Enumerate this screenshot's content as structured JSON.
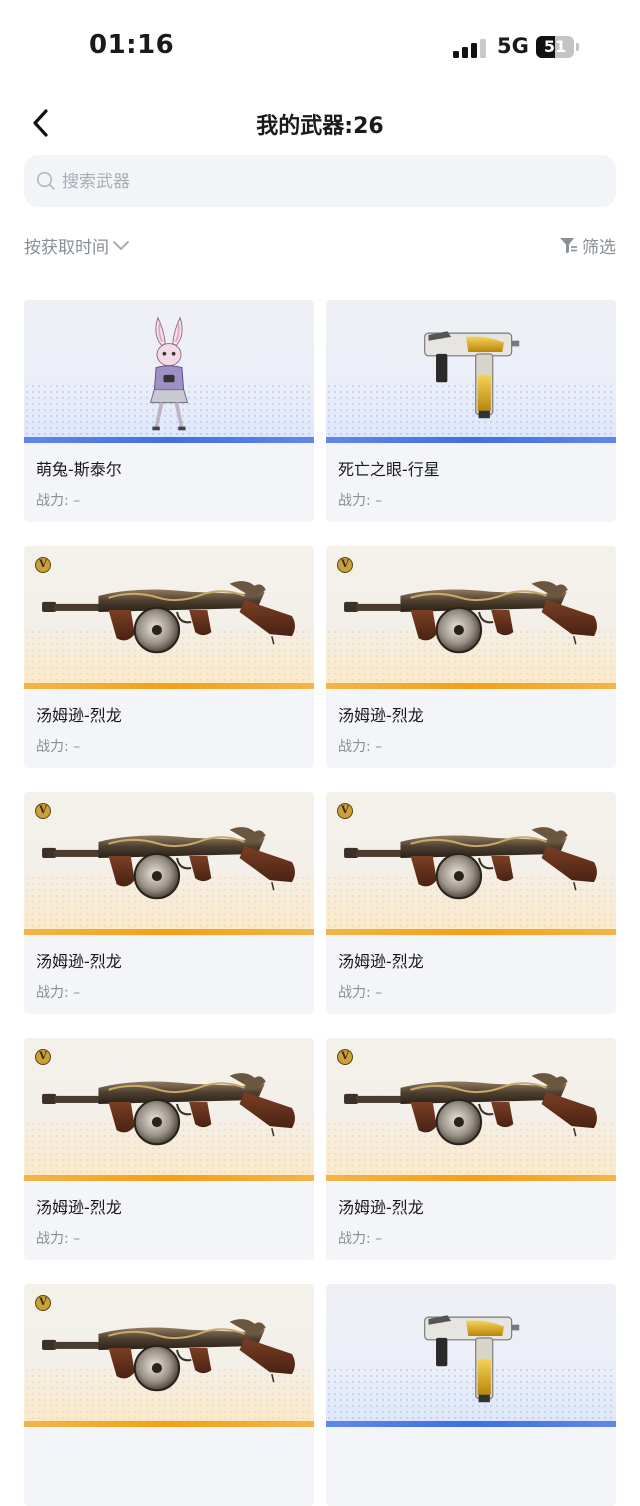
{
  "status": {
    "time": "01:16",
    "network": "5G",
    "battery": "51"
  },
  "header": {
    "title": "我的武器:26"
  },
  "search": {
    "placeholder": "搜索武器"
  },
  "toolbar": {
    "sort_label": "按获取时间",
    "filter_label": "筛选"
  },
  "weapons": [
    {
      "name": "萌兔-斯泰尔",
      "power": "战力: –",
      "rarity": "blue",
      "art": "bunny-character"
    },
    {
      "name": "死亡之眼-行星",
      "power": "战力: –",
      "rarity": "blue",
      "art": "smg-gold"
    },
    {
      "name": "汤姆逊-烈龙",
      "power": "战力: –",
      "rarity": "gold",
      "art": "thompson-dragon",
      "badge": "V"
    },
    {
      "name": "汤姆逊-烈龙",
      "power": "战力: –",
      "rarity": "gold",
      "art": "thompson-dragon",
      "badge": "V"
    },
    {
      "name": "汤姆逊-烈龙",
      "power": "战力: –",
      "rarity": "gold",
      "art": "thompson-dragon",
      "badge": "V"
    },
    {
      "name": "汤姆逊-烈龙",
      "power": "战力: –",
      "rarity": "gold",
      "art": "thompson-dragon",
      "badge": "V"
    },
    {
      "name": "汤姆逊-烈龙",
      "power": "战力: –",
      "rarity": "gold",
      "art": "thompson-dragon",
      "badge": "V"
    },
    {
      "name": "汤姆逊-烈龙",
      "power": "战力: –",
      "rarity": "gold",
      "art": "thompson-dragon",
      "badge": "V"
    },
    {
      "name": "",
      "power": "",
      "rarity": "gold",
      "art": "thompson-dragon",
      "badge": "V"
    },
    {
      "name": "",
      "power": "",
      "rarity": "blue",
      "art": "smg-gold"
    }
  ]
}
